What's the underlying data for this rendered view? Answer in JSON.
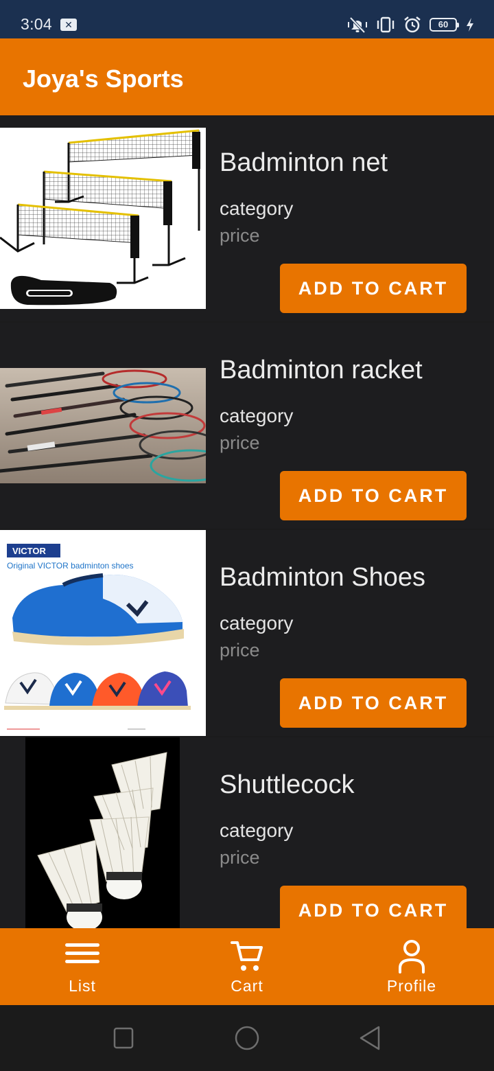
{
  "status_bar": {
    "time": "3:04",
    "notification_icon": "close-box-icon",
    "icons": [
      "vibrate-mute-icon",
      "vibrate-icon",
      "alarm-icon",
      "battery-icon",
      "charging-icon"
    ],
    "battery_level": "60"
  },
  "app_bar": {
    "title": "Joya's Sports"
  },
  "products": [
    {
      "name": "Badminton net",
      "category": "category",
      "price": "price",
      "button": "ADD TO CART",
      "image": "badminton-net-photo"
    },
    {
      "name": "Badminton racket",
      "category": "category",
      "price": "price",
      "button": "ADD TO CART",
      "image": "badminton-racket-photo"
    },
    {
      "name": "Badminton Shoes",
      "category": "category",
      "price": "price",
      "button": "ADD TO CART",
      "image": "badminton-shoes-photo",
      "image_texts": {
        "brand": "VICTOR",
        "caption": "Original VICTOR badminton shoes"
      }
    },
    {
      "name": "Shuttlecock",
      "category": "category",
      "price": "price",
      "button": "ADD TO CART",
      "image": "shuttlecock-photo"
    }
  ],
  "bottom_nav": {
    "items": [
      {
        "label": "List",
        "icon": "list-icon"
      },
      {
        "label": "Cart",
        "icon": "cart-icon"
      },
      {
        "label": "Profile",
        "icon": "profile-icon"
      }
    ]
  },
  "system_nav": {
    "buttons": [
      "recent-apps-icon",
      "home-icon",
      "back-icon"
    ]
  },
  "colors": {
    "accent": "#e87400",
    "status_bar": "#1b3050",
    "background": "#1d1d1f",
    "text_primary": "#ececec",
    "text_secondary": "#8b8b8b"
  }
}
